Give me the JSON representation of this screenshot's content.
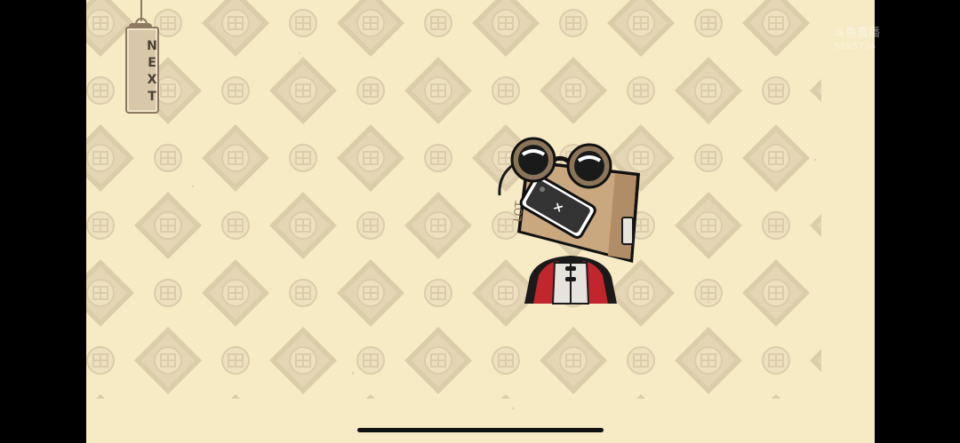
{
  "game": {
    "next_label": "NEXT"
  },
  "watermark": {
    "title": "斗鱼直播",
    "room_id": "5595734"
  },
  "colors": {
    "background": "#f6ebc5",
    "diamond": "#d9c9a5",
    "medallion": "#e7dab9",
    "tag": "#d8c7a9"
  },
  "icons": {
    "character": "box-head-character",
    "background_motif": "shou-longevity-medallion"
  }
}
